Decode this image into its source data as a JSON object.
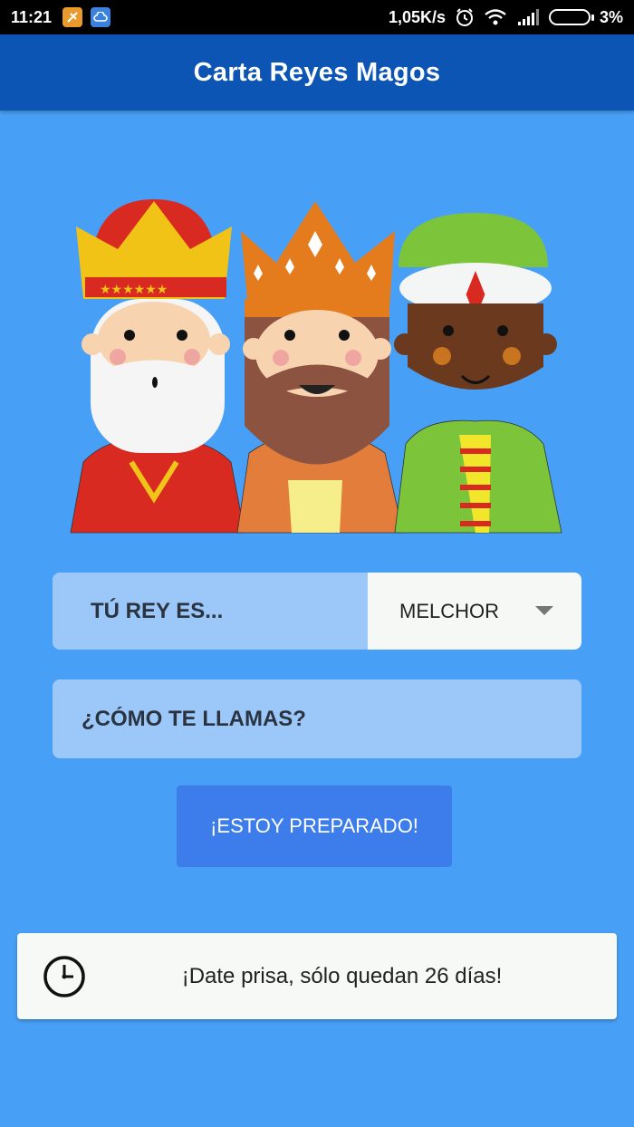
{
  "status_bar": {
    "time": "11:21",
    "network_speed": "1,05K/s",
    "battery": "3%",
    "icons": [
      "app-notification-icon",
      "cloud-icon",
      "alarm-icon",
      "wifi-icon",
      "signal-icon",
      "battery-icon"
    ]
  },
  "app_bar": {
    "title": "Carta Reyes Magos"
  },
  "illustration": {
    "kings": [
      "Melchor",
      "Gaspar",
      "Baltasar"
    ]
  },
  "king_selector": {
    "label": "TÚ REY ES...",
    "selected": "MELCHOR"
  },
  "name_input": {
    "placeholder": "¿CÓMO TE LLAMAS?",
    "value": ""
  },
  "ready_button": {
    "label": "¡ESTOY PREPARADO!"
  },
  "countdown": {
    "text": "¡Date prisa, sólo quedan 26 días!"
  },
  "colors": {
    "background": "#48a0f6",
    "app_bar": "#0d55b5",
    "button": "#3d7deb",
    "field": "#9bc8f8"
  }
}
